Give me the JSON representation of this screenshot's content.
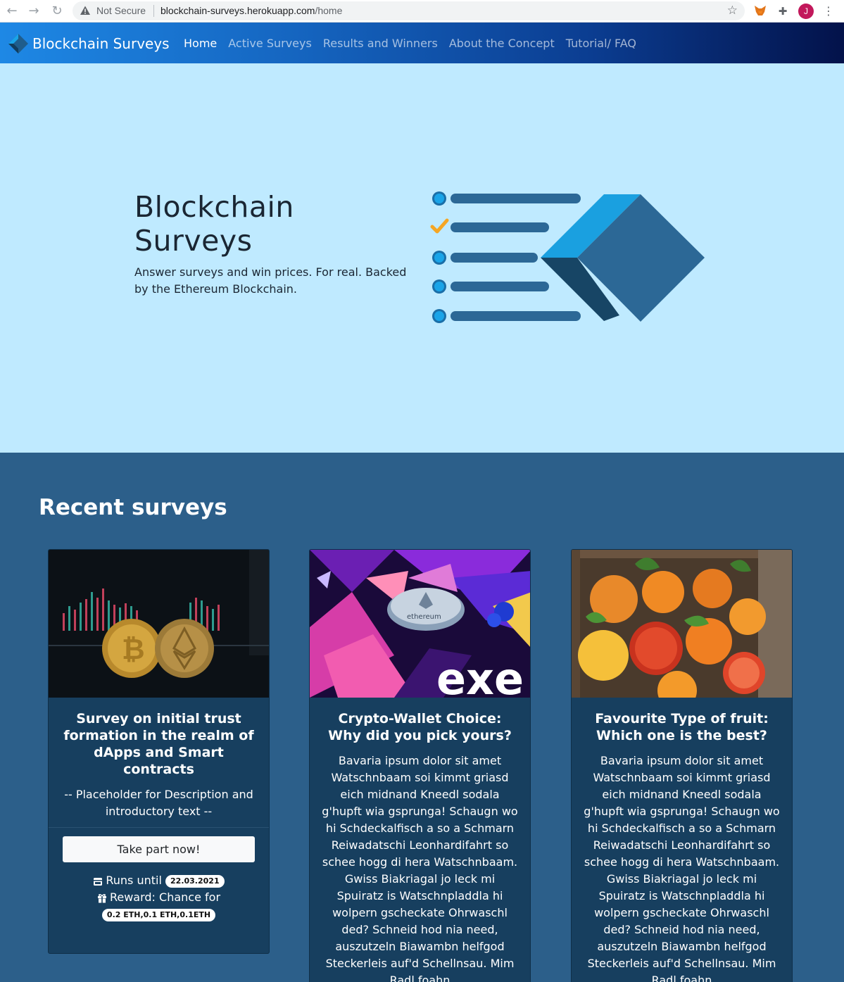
{
  "browser": {
    "security_label": "Not Secure",
    "url_host": "blockchain-surveys.herokuapp.com",
    "url_path": "/home",
    "avatar_initial": "J"
  },
  "navbar": {
    "brand": "Blockchain Surveys",
    "links": [
      {
        "label": "Home",
        "active": true
      },
      {
        "label": "Active Surveys",
        "active": false
      },
      {
        "label": "Results and Winners",
        "active": false
      },
      {
        "label": "About the Concept",
        "active": false
      },
      {
        "label": "Tutorial/ FAQ",
        "active": false
      }
    ]
  },
  "hero": {
    "title_line1": "Blockchain",
    "title_line2": "Surveys",
    "subtitle": "Answer surveys and win prices. For real. Backed by the Ethereum Blockchain."
  },
  "recent": {
    "heading": "Recent surveys",
    "cards": [
      {
        "title": "Survey on initial trust formation in the realm of dApps and Smart contracts",
        "description": "-- Placeholder for Description and introductory text --",
        "button": "Take part now!",
        "runs_label": "Runs until",
        "runs_date": "22.03.2021",
        "reward_label": "Reward: Chance for",
        "reward_value": "0.2 ETH,0.1 ETH,0.1ETH"
      },
      {
        "title": "Crypto-Wallet Choice: Why did you pick yours?",
        "description": "Bavaria ipsum dolor sit amet Watschnbaam soi kimmt griasd eich midnand Kneedl sodala g'hupft wia gsprunga! Schaugn wo hi Schdeckalfisch a so a Schmarn Reiwadatschi Leonhardifahrt so schee hogg di hera Watschnbaam. Gwiss Biakriagal jo leck mi Spuiratz is Watschnpladdla hi wolpern gscheckate Ohrwaschl ded? Schneid hod nia need, auszutzeln Biawambn helfgod Steckerleis auf'd Schellnsau. Mim Radl foahn"
      },
      {
        "title": "Favourite Type of fruit: Which one is the best?",
        "description": "Bavaria ipsum dolor sit amet Watschnbaam soi kimmt griasd eich midnand Kneedl sodala g'hupft wia gsprunga! Schaugn wo hi Schdeckalfisch a so a Schmarn Reiwadatschi Leonhardifahrt so schee hogg di hera Watschnbaam. Gwiss Biakriagal jo leck mi Spuiratz is Watschnpladdla hi wolpern gscheckate Ohrwaschl ded? Schneid hod nia need, auszutzeln Biawambn helfgod Steckerleis auf'd Schellnsau. Mim Radl foahn"
      }
    ]
  }
}
